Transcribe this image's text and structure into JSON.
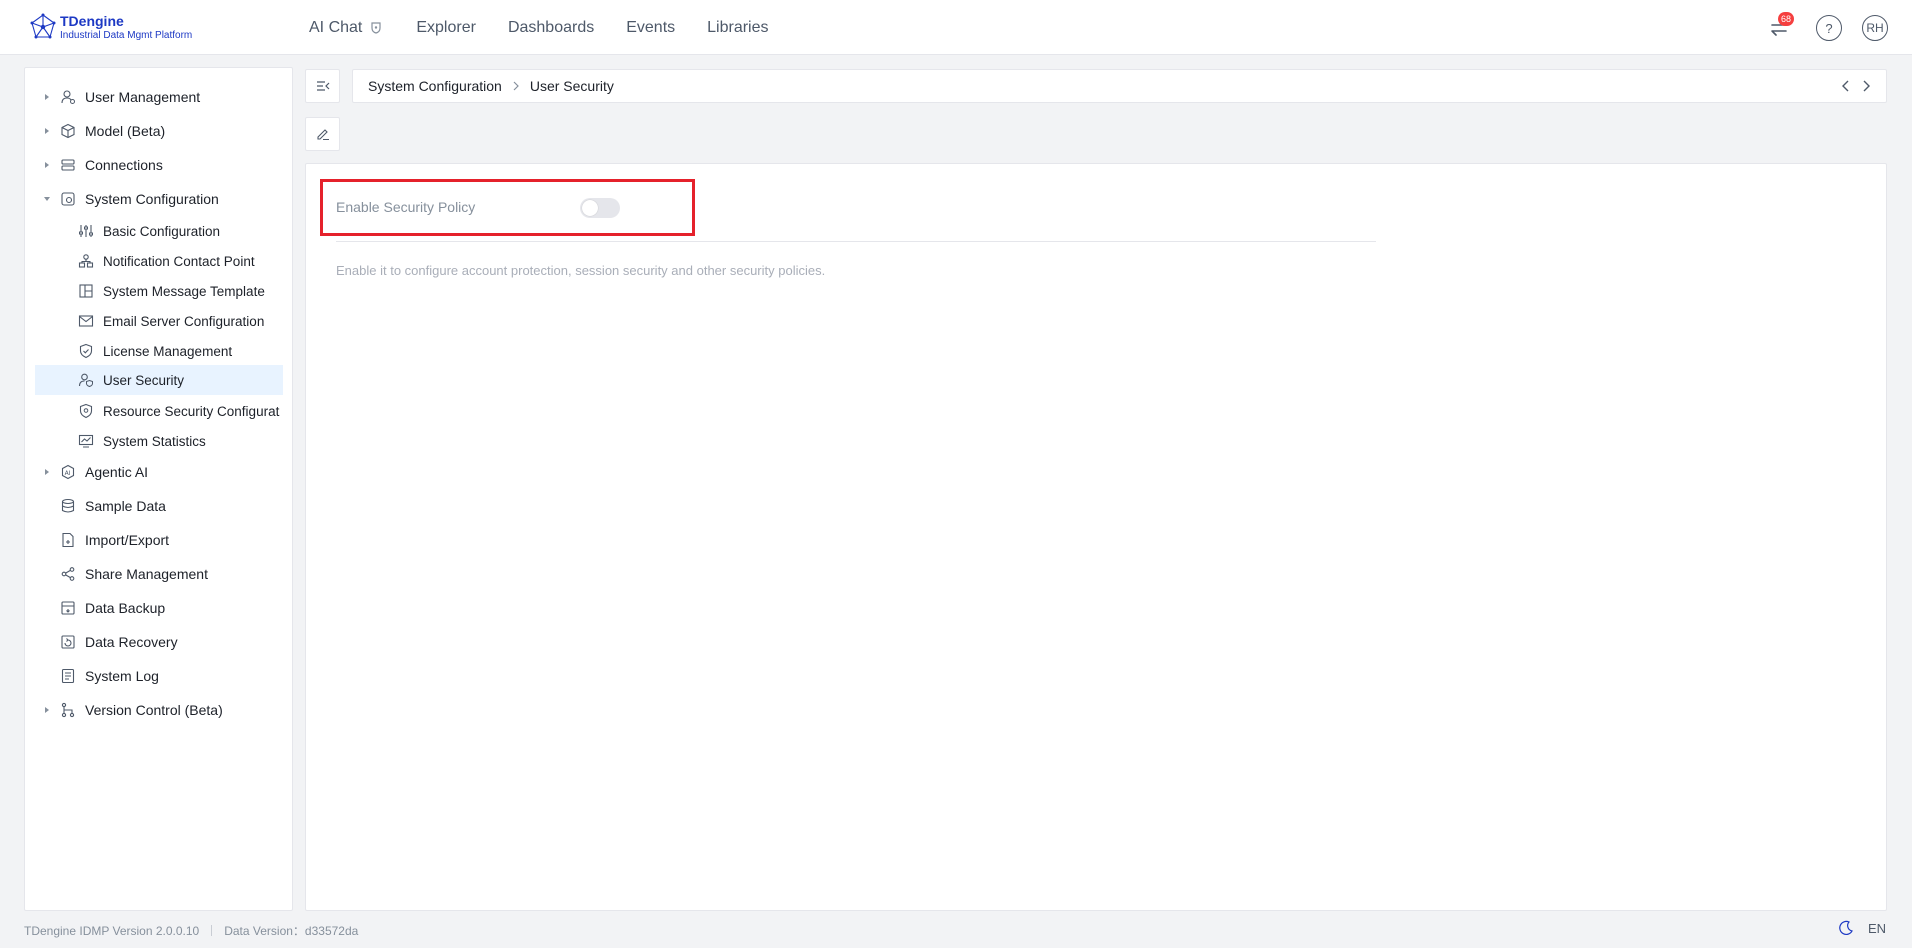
{
  "app": {
    "title": "TDengine",
    "subtitle": "Industrial Data Mgmt Platform"
  },
  "nav": {
    "items": [
      {
        "label": "AI Chat"
      },
      {
        "label": "Explorer"
      },
      {
        "label": "Dashboards"
      },
      {
        "label": "Events"
      },
      {
        "label": "Libraries"
      }
    ]
  },
  "header": {
    "notification_count": "68",
    "help_label": "?",
    "avatar_initials": "RH"
  },
  "sidebar": {
    "items": [
      {
        "label": "User Management",
        "icon": "user-manage-icon",
        "expanded": false
      },
      {
        "label": "Model (Beta)",
        "icon": "cube-icon",
        "expanded": false
      },
      {
        "label": "Connections",
        "icon": "connections-icon",
        "expanded": false
      },
      {
        "label": "System Configuration",
        "icon": "system-config-icon",
        "expanded": true
      },
      {
        "label": "Basic Configuration",
        "icon": "sliders-icon"
      },
      {
        "label": "Notification Contact Point",
        "icon": "contact-point-icon"
      },
      {
        "label": "System Message Template",
        "icon": "template-icon"
      },
      {
        "label": "Email Server Configuration",
        "icon": "mail-icon"
      },
      {
        "label": "License Management",
        "icon": "shield-check-icon"
      },
      {
        "label": "User Security",
        "icon": "user-security-icon",
        "active": true
      },
      {
        "label": "Resource Security Configurat",
        "icon": "resource-security-icon"
      },
      {
        "label": "System Statistics",
        "icon": "statistics-icon"
      },
      {
        "label": "Agentic AI",
        "icon": "ai-icon",
        "expanded": false
      },
      {
        "label": "Sample Data",
        "icon": "database-icon"
      },
      {
        "label": "Import/Export",
        "icon": "import-export-icon"
      },
      {
        "label": "Share Management",
        "icon": "share-icon"
      },
      {
        "label": "Data Backup",
        "icon": "backup-icon"
      },
      {
        "label": "Data Recovery",
        "icon": "recovery-icon"
      },
      {
        "label": "System Log",
        "icon": "log-icon"
      },
      {
        "label": "Version Control (Beta)",
        "icon": "version-control-icon",
        "expanded": false
      }
    ]
  },
  "breadcrumb": {
    "items": [
      "System Configuration",
      "User Security"
    ]
  },
  "content": {
    "field_label": "Enable Security Policy",
    "switch_on": false,
    "description": "Enable it to configure account protection, session security and other security policies."
  },
  "footer": {
    "version": "TDengine IDMP Version 2.0.0.10",
    "data_version": "Data Version：d33572da",
    "language": "EN"
  },
  "colors": {
    "brand": "#1d39c4",
    "highlight": "#e5212b",
    "active_bg": "#e8f3ff",
    "badge": "#f53f3f"
  }
}
